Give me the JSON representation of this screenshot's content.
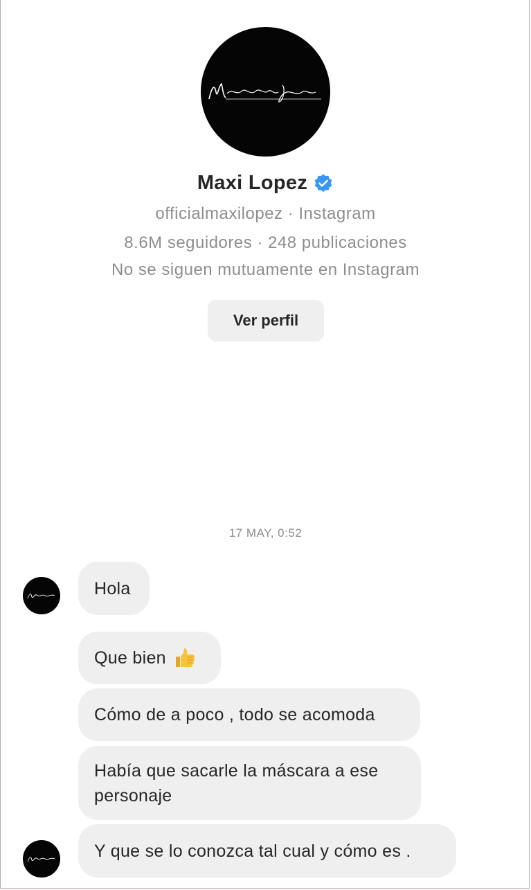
{
  "profile": {
    "avatar_signature": "Maximiliano Lopez",
    "name": "Maxi Lopez",
    "verified": true,
    "verified_icon": "verified-badge-icon",
    "username_line": "officialmaxilopez · Instagram",
    "stats_line": "8.6M seguidores · 248 publicaciones",
    "relationship_line": "No se siguen mutuamente en Instagram",
    "view_profile_label": "Ver perfil"
  },
  "conversation": {
    "timestamp": "17 MAY, 0:52",
    "messages": [
      {
        "text": "Hola"
      },
      {
        "text": "Que bien",
        "emoji_icon": "thumbs-up-icon"
      },
      {
        "text": "Cómo de a poco , todo se acomoda"
      },
      {
        "text": "Había que sacarle la máscara a ese personaje"
      },
      {
        "text": "Y que se lo conozca tal cual y cómo es ."
      }
    ]
  },
  "colors": {
    "bubble_bg": "#efefef",
    "meta_text": "#8e8e8e",
    "verified_blue": "#3897f0",
    "avatar_bg": "#050505"
  }
}
